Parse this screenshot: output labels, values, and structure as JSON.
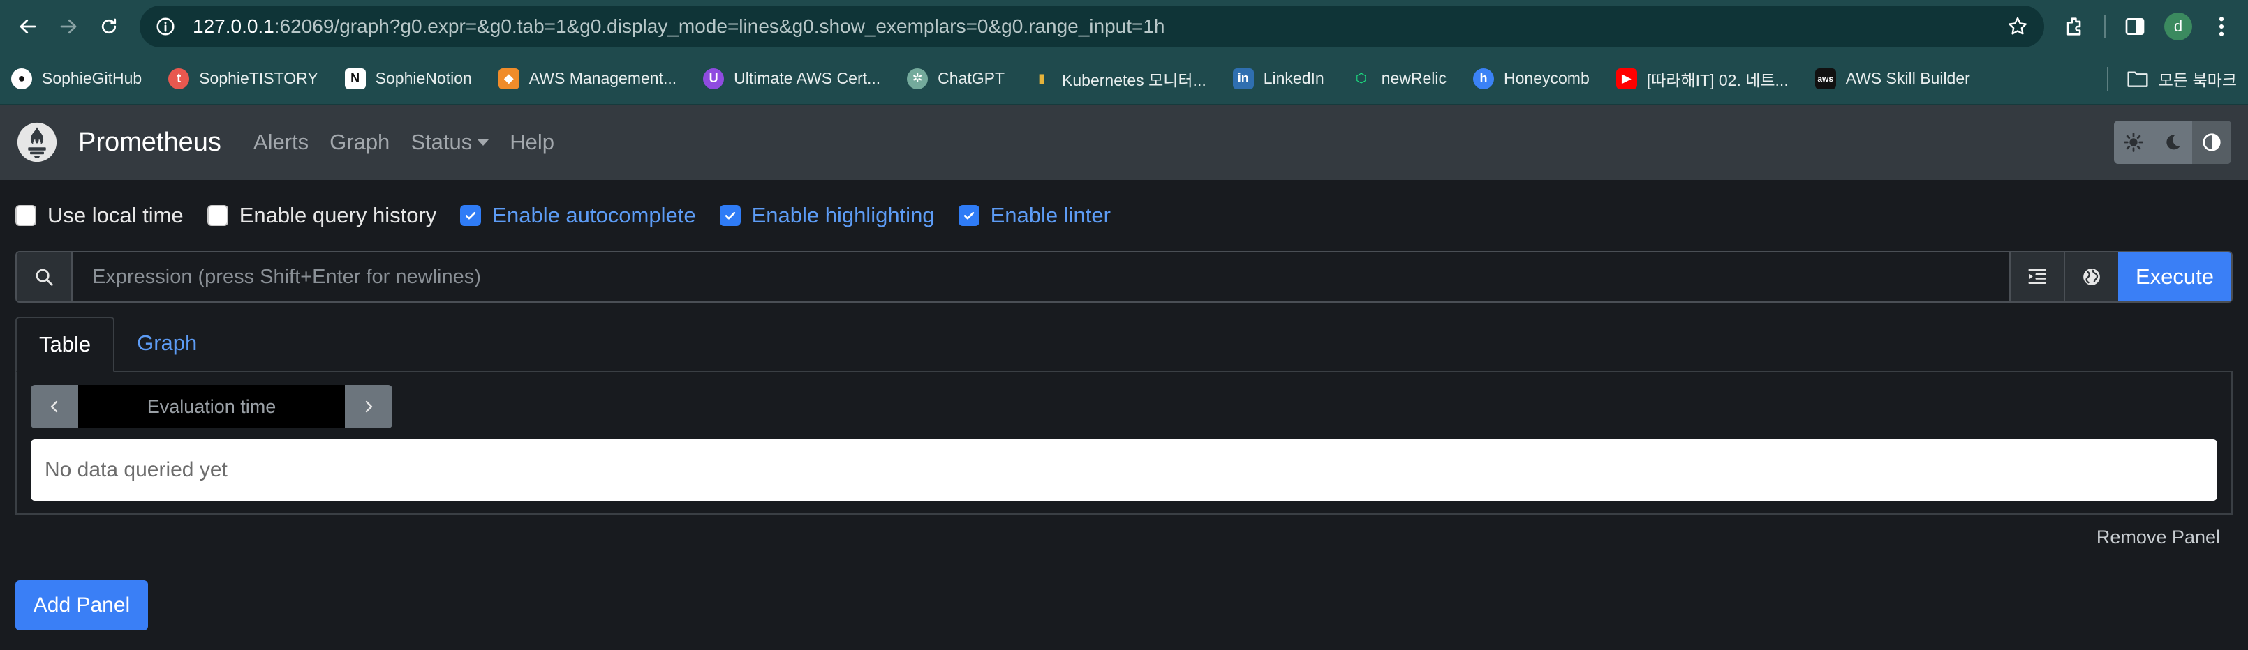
{
  "browser": {
    "url_host": "127.0.0.1",
    "url_rest": ":62069/graph?g0.expr=&g0.tab=1&g0.display_mode=lines&g0.show_exemplars=0&g0.range_input=1h",
    "avatar_letter": "d",
    "bookmarks": [
      {
        "label": "SophieGitHub",
        "icon": "github-icon",
        "color": "#ffffff"
      },
      {
        "label": "SophieTISTORY",
        "icon": "tistory-icon",
        "color": "#e8584f"
      },
      {
        "label": "SophieNotion",
        "icon": "notion-icon",
        "color": "#ffffff"
      },
      {
        "label": "AWS Management...",
        "icon": "aws-cube-icon",
        "color": "#f08c2a"
      },
      {
        "label": "Ultimate AWS Cert...",
        "icon": "udemy-icon",
        "color": "#8f4be0"
      },
      {
        "label": "ChatGPT",
        "icon": "chatgpt-icon",
        "color": "#74aa9c"
      },
      {
        "label": "Kubernetes 모니터...",
        "icon": "bar-chart-icon",
        "color": "#e5b33b"
      },
      {
        "label": "LinkedIn",
        "icon": "linkedin-icon",
        "color": "#2f6fb0"
      },
      {
        "label": "newRelic",
        "icon": "newrelic-icon",
        "color": "#1ce783"
      },
      {
        "label": "Honeycomb",
        "icon": "honeycomb-icon",
        "color": "#3b82f6"
      },
      {
        "label": "[따라해IT] 02. 네트...",
        "icon": "youtube-icon",
        "color": "#ff0000"
      },
      {
        "label": "AWS Skill Builder",
        "icon": "aws-icon",
        "color": "#111111"
      }
    ],
    "bookmarks_folder": "모든 북마크"
  },
  "navbar": {
    "brand": "Prometheus",
    "links": [
      "Alerts",
      "Graph",
      "Status",
      "Help"
    ]
  },
  "options": [
    {
      "label": "Use local time",
      "checked": false
    },
    {
      "label": "Enable query history",
      "checked": false
    },
    {
      "label": "Enable autocomplete",
      "checked": true
    },
    {
      "label": "Enable highlighting",
      "checked": true
    },
    {
      "label": "Enable linter",
      "checked": true
    }
  ],
  "query": {
    "placeholder": "Expression (press Shift+Enter for newlines)",
    "value": "",
    "execute_label": "Execute"
  },
  "panel": {
    "tabs": [
      "Table",
      "Graph"
    ],
    "active_tab": "Table",
    "eval_time_placeholder": "Evaluation time",
    "no_data": "No data queried yet",
    "remove_label": "Remove Panel"
  },
  "add_panel_label": "Add Panel",
  "colors": {
    "accent": "#3a7ff6",
    "link": "#5d9cf5",
    "navbar_bg": "#343a40",
    "page_bg": "#181b1f",
    "chrome_bg": "#1f4a4d"
  }
}
